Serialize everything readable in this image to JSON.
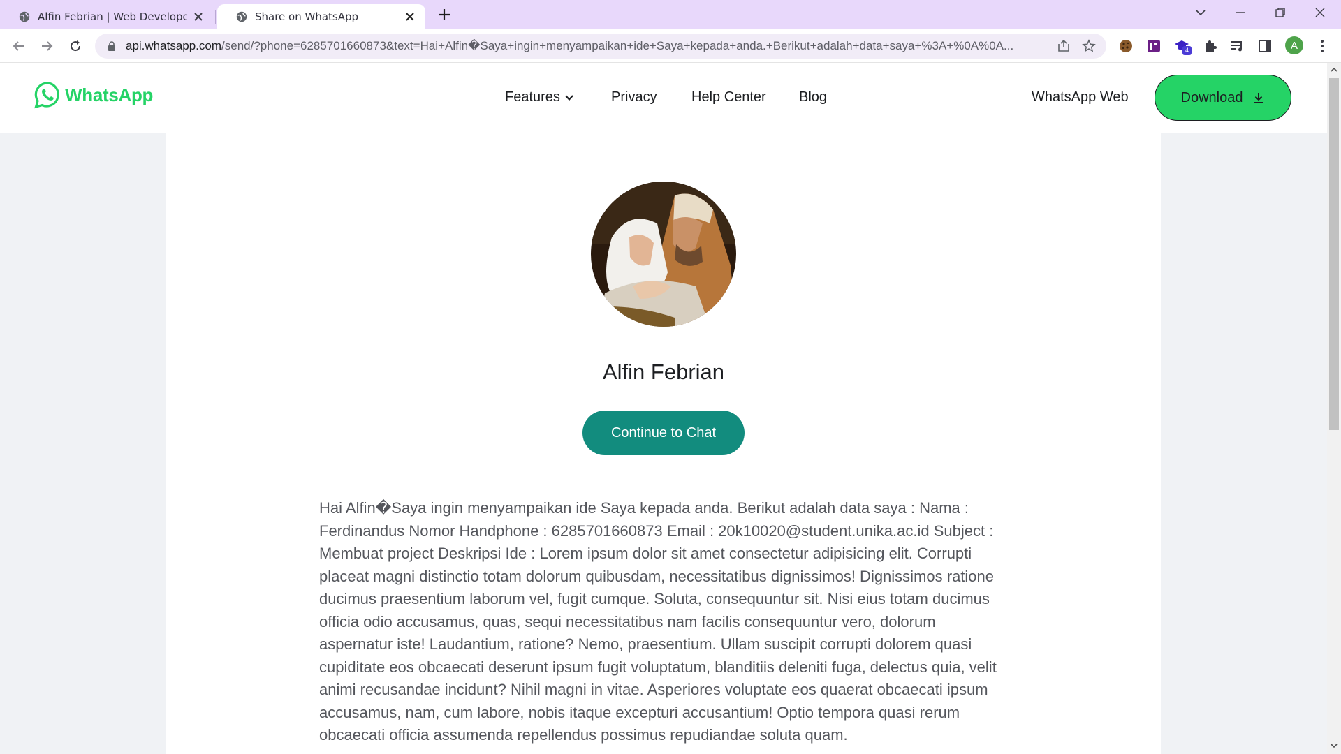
{
  "browser": {
    "tabs": [
      {
        "title": "Alfin Febrian | Web Developer & ",
        "active": false
      },
      {
        "title": "Share on WhatsApp",
        "active": true
      }
    ],
    "url_host": "api.whatsapp.com",
    "url_rest": "/send/?phone=6285701660873&text=Hai+Alfin�Saya+ingin+menyampaikan+ide+Saya+kepada+anda.+Berikut+adalah+data+saya+%3A+%0A%0A...",
    "profile_initial": "A",
    "extension_badge": "4",
    "theme_color": "#e8d8fb"
  },
  "header": {
    "brand": "WhatsApp",
    "nav": [
      "Features",
      "Privacy",
      "Help Center",
      "Blog"
    ],
    "web_link": "WhatsApp Web",
    "download_label": "Download",
    "brand_color": "#25d366"
  },
  "main": {
    "contact_name": "Alfin Febrian",
    "continue_label": "Continue to Chat",
    "button_color": "#128c7e",
    "message": "Hai Alfin�Saya ingin menyampaikan ide Saya kepada anda. Berikut adalah data saya : Nama : Ferdinandus Nomor Handphone : 6285701660873 Email : 20k10020@student.unika.ac.id Subject : Membuat project Deskripsi Ide : Lorem ipsum dolor sit amet consectetur adipisicing elit. Corrupti placeat magni distinctio totam dolorum quibusdam, necessitatibus dignissimos! Dignissimos ratione ducimus praesentium laborum vel, fugit cumque. Soluta, consequuntur sit. Nisi eius totam ducimus officia odio accusamus, quas, sequi necessitatibus nam facilis consequuntur vero, dolorum aspernatur iste! Laudantium, ratione? Nemo, praesentium. Ullam suscipit corrupti dolorem quasi cupiditate eos obcaecati deserunt ipsum fugit voluptatum, blanditiis deleniti fuga, delectus quia, velit animi recusandae incidunt? Nihil magni in vitae. Asperiores voluptate eos quaerat obcaecati ipsum accusamus, nam, cum labore, nobis itaque excepturi accusantium! Optio tempora quasi rerum obcaecati officia assumenda repellendus possimus repudiandae soluta quam."
  }
}
